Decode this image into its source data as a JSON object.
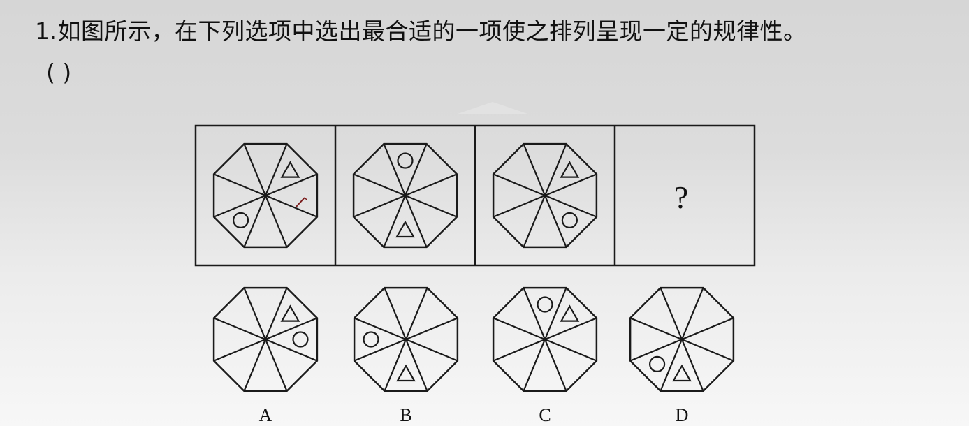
{
  "question": {
    "text": "1.如图所示，在下列选项中选出最合适的一项使之排列呈现一定的规律性。",
    "answer_blank": "( )"
  },
  "sequence": [
    {
      "triangle_sector": 1,
      "circle_sector": 5
    },
    {
      "circle_sector": 0,
      "triangle_sector": 4
    },
    {
      "triangle_sector": 1,
      "circle_sector": 3
    },
    {
      "missing_mark": "?"
    }
  ],
  "options": [
    {
      "label": "A",
      "triangle_sector": 1,
      "circle_sector": 2
    },
    {
      "label": "B",
      "circle_sector": 6,
      "triangle_sector": 4
    },
    {
      "label": "C",
      "triangle_sector": 1,
      "circle_sector": 0
    },
    {
      "label": "D",
      "circle_sector": 5,
      "triangle_sector": 4
    }
  ]
}
